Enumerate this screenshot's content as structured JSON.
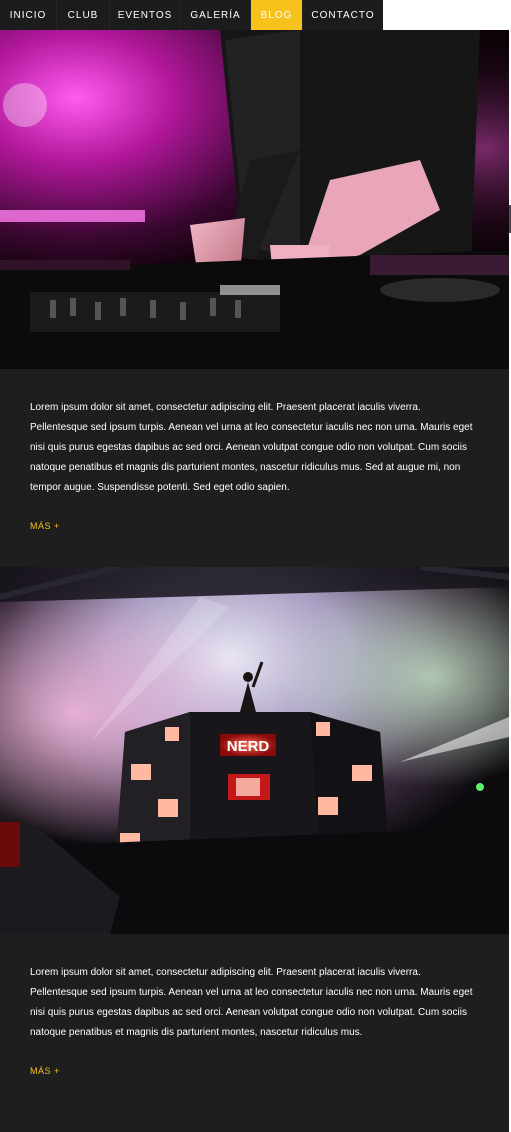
{
  "nav": {
    "items": [
      {
        "label": "INICIO"
      },
      {
        "label": "CLUB"
      },
      {
        "label": "EVENTOS"
      },
      {
        "label": "GALERÍA"
      },
      {
        "label": "BLOG"
      },
      {
        "label": "CONTACTO"
      }
    ],
    "active": "BLOG"
  },
  "posts": [
    {
      "image": "dj-mixing-photo",
      "text": "Lorem ipsum dolor sit amet, consectetur adipiscing elit. Praesent placerat iaculis viverra. Pellentesque sed ipsum turpis. Aenean vel urna at leo consectetur iaculis nec non urna. Mauris eget nisi quis purus egestas dapibus ac sed orci. Aenean volutpat congue odio non volutpat. Cum sociis natoque penatibus et magnis dis parturient montes, nascetur ridiculus mus. Sed at augue mi, non tempor augue. Suspendisse potenti. Sed eget odio sapien.",
      "more_label": "MÁS",
      "more_icon": "+"
    },
    {
      "image": "concert-stage-photo",
      "stage_sign": "NERD",
      "text": "Lorem ipsum dolor sit amet, consectetur adipiscing elit. Praesent placerat iaculis viverra. Pellentesque sed ipsum turpis. Aenean vel urna at leo consectetur iaculis nec non urna. Mauris eget nisi quis purus egestas dapibus ac sed orci. Aenean volutpat congue odio non volutpat. Cum sociis natoque penatibus et magnis dis parturient montes, nascetur ridiculus mus.",
      "more_label": "MÁS",
      "more_icon": "+"
    }
  ],
  "colors": {
    "accent": "#f8c21c",
    "nav_bg": "#1c1c1c",
    "post_bg": "#1e1e1e",
    "text": "#ffffff"
  }
}
